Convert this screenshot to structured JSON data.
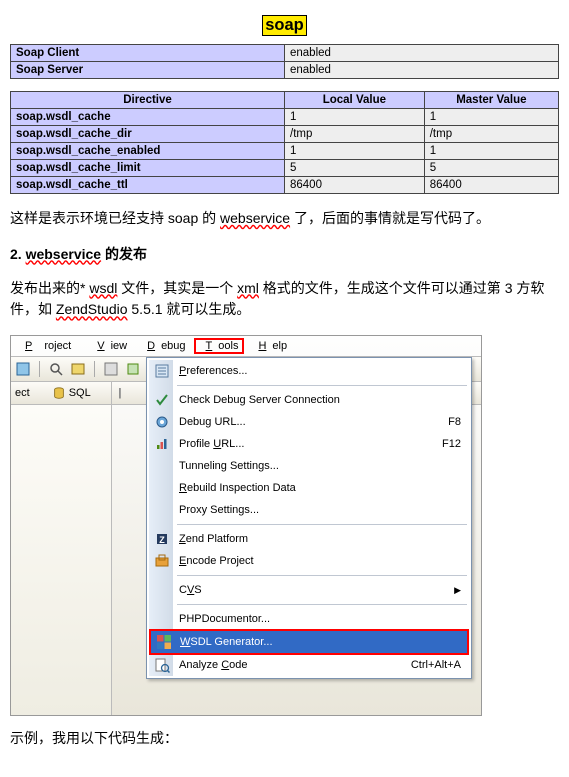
{
  "banner": "soap",
  "table1": {
    "rows": [
      {
        "label": "Soap Client",
        "val": "enabled"
      },
      {
        "label": "Soap Server",
        "val": "enabled"
      }
    ]
  },
  "table2": {
    "headers": [
      "Directive",
      "Local Value",
      "Master Value"
    ],
    "rows": [
      {
        "k": "soap.wsdl_cache",
        "lv": "1",
        "mv": "1"
      },
      {
        "k": "soap.wsdl_cache_dir",
        "lv": "/tmp",
        "mv": "/tmp"
      },
      {
        "k": "soap.wsdl_cache_enabled",
        "lv": "1",
        "mv": "1"
      },
      {
        "k": "soap.wsdl_cache_limit",
        "lv": "5",
        "mv": "5"
      },
      {
        "k": "soap.wsdl_cache_ttl",
        "lv": "86400",
        "mv": "86400"
      }
    ]
  },
  "para1_a": "这样是表示环境已经支持 soap 的 ",
  "para1_wavy": "webservice",
  "para1_b": " 了，后面的事情就是写代码了。",
  "sect_num": "2.  ",
  "sect_wavy": "webservice",
  "sect_suffix": " 的发布",
  "para2_a": "发布出来的* ",
  "para2_wsdl": "wsdl",
  "para2_b": " 文件，其实是一个 ",
  "para2_xml": "xml",
  "para2_c": " 格式的文件，生成这个文件可以通过第 3 方软件，如 ",
  "para2_zs": "ZendStudio",
  "para2_d": " 5.5.1 就可以生成。",
  "menubar": {
    "project": "Project",
    "view": "View",
    "debug": "Debug",
    "tools": "Tools",
    "help": "Help"
  },
  "subrow": {
    "ect": "ect",
    "sql": "SQL"
  },
  "menu": {
    "preferences": "Preferences...",
    "checkdebug": "Check Debug Server Connection",
    "debugurl": "Debug URL...",
    "debugurl_sc": "F8",
    "profileurl": "Profile URL...",
    "profileurl_sc": "F12",
    "tunneling": "Tunneling Settings...",
    "rebuild": "Rebuild Inspection Data",
    "proxy": "Proxy Settings...",
    "zendplat": "Zend Platform",
    "encode": "Encode Project",
    "cvs": "CVS",
    "phpdoc": "PHPDocumentor...",
    "wsdl": "WSDL Generator...",
    "analyze": "Analyze Code",
    "analyze_sc": "Ctrl+Alt+A"
  },
  "footer": "示例，我用以下代码生成："
}
